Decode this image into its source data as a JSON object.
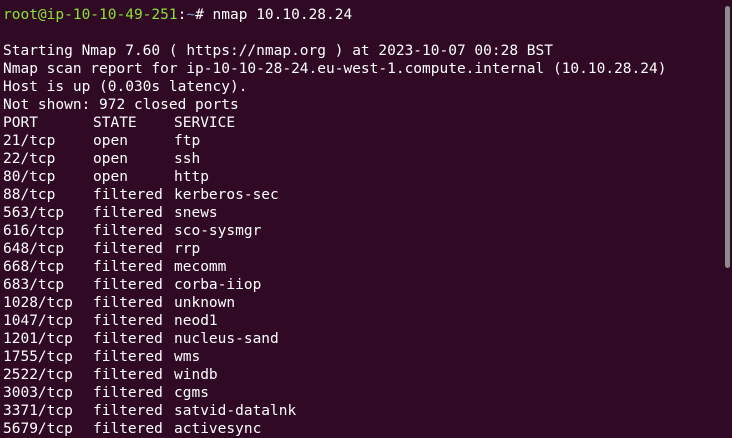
{
  "prompt": {
    "user_host": "root@ip-10-10-49-251",
    "separator": ":",
    "path": "~",
    "symbol": "# ",
    "command": "nmap 10.10.28.24"
  },
  "output": {
    "blank": "",
    "start_line": "Starting Nmap 7.60 ( https://nmap.org ) at 2023-10-07 00:28 BST",
    "report_line": "Nmap scan report for ip-10-10-28-24.eu-west-1.compute.internal (10.10.28.24)",
    "host_line": "Host is up (0.030s latency).",
    "not_shown_line": "Not shown: 972 closed ports",
    "headers": {
      "port": "PORT",
      "state": "STATE",
      "service": "SERVICE"
    },
    "rows": [
      {
        "port": "21/tcp",
        "state": "open",
        "service": "ftp"
      },
      {
        "port": "22/tcp",
        "state": "open",
        "service": "ssh"
      },
      {
        "port": "80/tcp",
        "state": "open",
        "service": "http"
      },
      {
        "port": "88/tcp",
        "state": "filtered",
        "service": "kerberos-sec"
      },
      {
        "port": "563/tcp",
        "state": "filtered",
        "service": "snews"
      },
      {
        "port": "616/tcp",
        "state": "filtered",
        "service": "sco-sysmgr"
      },
      {
        "port": "648/tcp",
        "state": "filtered",
        "service": "rrp"
      },
      {
        "port": "668/tcp",
        "state": "filtered",
        "service": "mecomm"
      },
      {
        "port": "683/tcp",
        "state": "filtered",
        "service": "corba-iiop"
      },
      {
        "port": "1028/tcp",
        "state": "filtered",
        "service": "unknown"
      },
      {
        "port": "1047/tcp",
        "state": "filtered",
        "service": "neod1"
      },
      {
        "port": "1201/tcp",
        "state": "filtered",
        "service": "nucleus-sand"
      },
      {
        "port": "1755/tcp",
        "state": "filtered",
        "service": "wms"
      },
      {
        "port": "2522/tcp",
        "state": "filtered",
        "service": "windb"
      },
      {
        "port": "3003/tcp",
        "state": "filtered",
        "service": "cgms"
      },
      {
        "port": "3371/tcp",
        "state": "filtered",
        "service": "satvid-datalnk"
      },
      {
        "port": "5679/tcp",
        "state": "filtered",
        "service": "activesync"
      }
    ]
  },
  "colors": {
    "background": "#300a24",
    "text": "#ffffff",
    "user_host": "#8ae234",
    "path": "#729fcf",
    "scrollbar": "#8c8c8c"
  }
}
